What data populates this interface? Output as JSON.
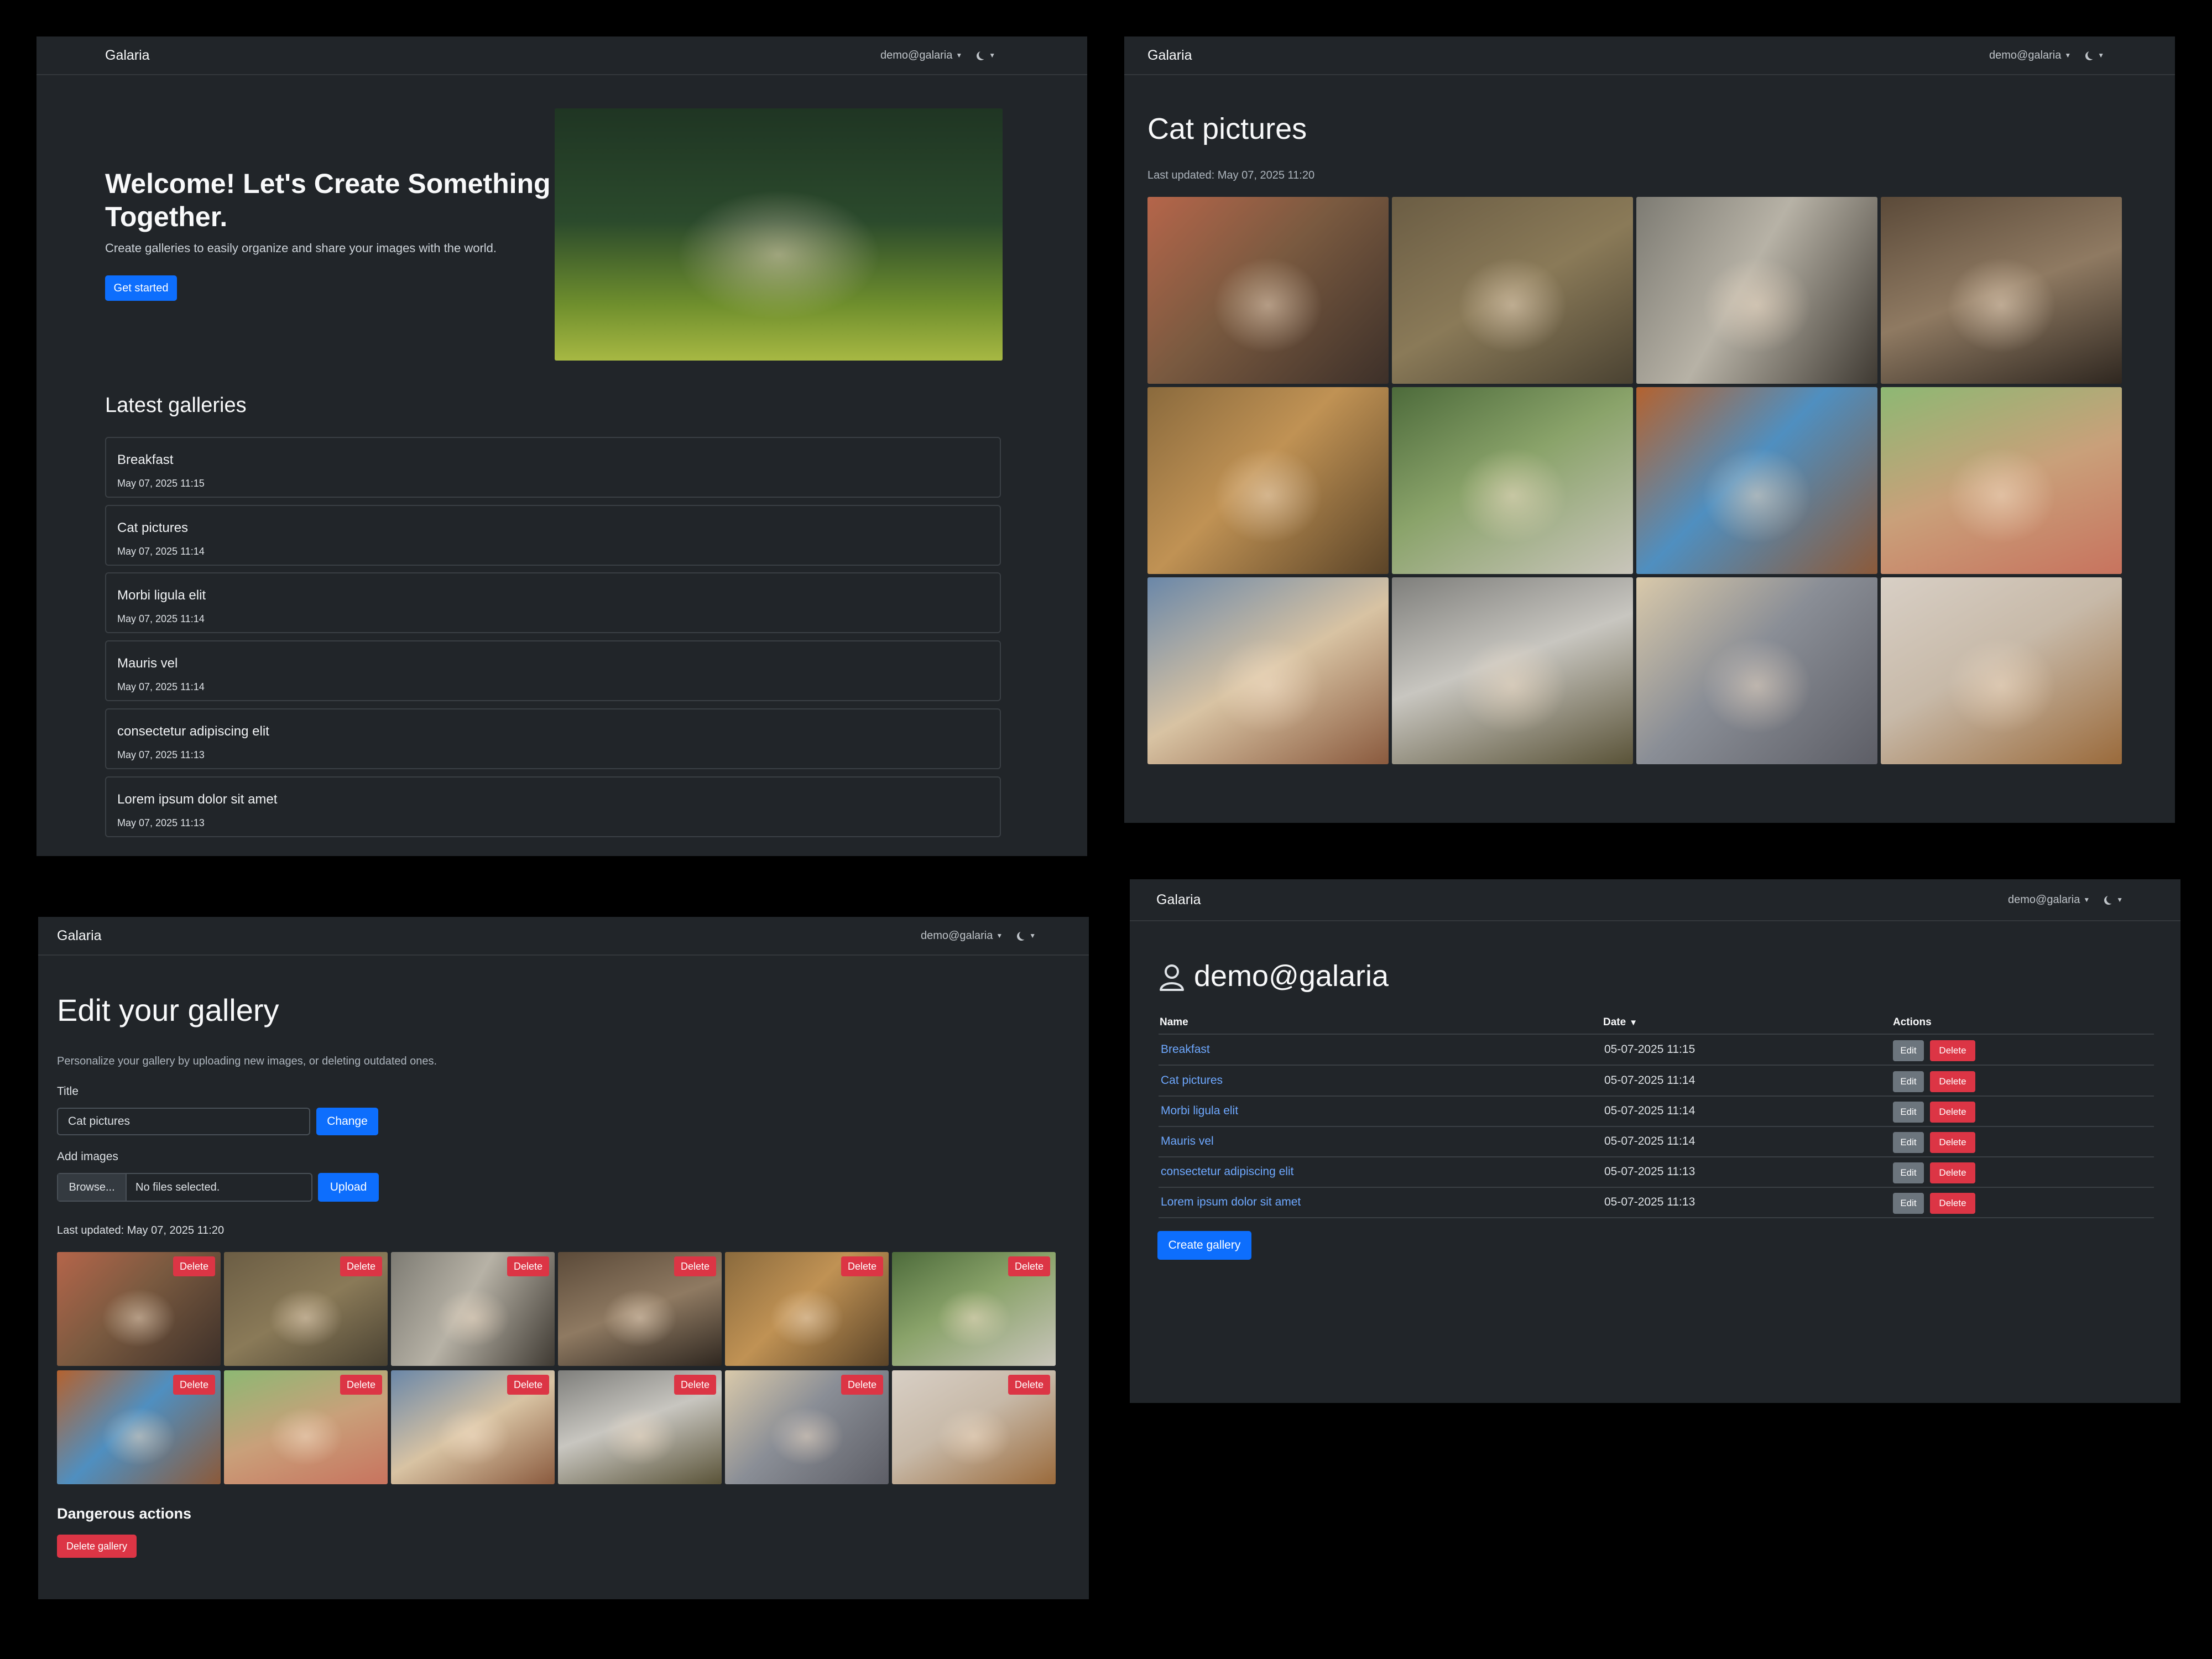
{
  "app": {
    "brand": "Galaria",
    "user": "demo@galaria"
  },
  "home": {
    "welcome_title": "Welcome! Let's Create Something Together.",
    "welcome_subtitle": "Create galleries to easily organize and share your images with the world.",
    "get_started_label": "Get started",
    "latest_title": "Latest galleries",
    "galleries": [
      {
        "name": "Breakfast",
        "date": "May 07, 2025 11:15"
      },
      {
        "name": "Cat pictures",
        "date": "May 07, 2025 11:14"
      },
      {
        "name": "Morbi ligula elit",
        "date": "May 07, 2025 11:14"
      },
      {
        "name": "Mauris vel",
        "date": "May 07, 2025 11:14"
      },
      {
        "name": "consectetur adipiscing elit",
        "date": "May 07, 2025 11:13"
      },
      {
        "name": "Lorem ipsum dolor sit amet",
        "date": "May 07, 2025 11:13"
      }
    ]
  },
  "gallery": {
    "title": "Cat pictures",
    "last_updated": "Last updated: May 07, 2025 11:20"
  },
  "edit": {
    "title": "Edit your gallery",
    "description": "Personalize your gallery by uploading new images, or deleting outdated ones.",
    "title_label": "Title",
    "title_value": "Cat pictures",
    "change_label": "Change",
    "add_images_label": "Add images",
    "browse_label": "Browse...",
    "no_files_label": "No files selected.",
    "upload_label": "Upload",
    "last_updated": "Last updated: May 07, 2025 11:20",
    "delete_label": "Delete",
    "dangerous_title": "Dangerous actions",
    "delete_gallery_label": "Delete gallery"
  },
  "profile": {
    "title": "demo@galaria",
    "columns": {
      "name": "Name",
      "date": "Date",
      "actions": "Actions"
    },
    "rows": [
      {
        "name": "Breakfast",
        "date": "05-07-2025 11:15"
      },
      {
        "name": "Cat pictures",
        "date": "05-07-2025 11:14"
      },
      {
        "name": "Morbi ligula elit",
        "date": "05-07-2025 11:14"
      },
      {
        "name": "Mauris vel",
        "date": "05-07-2025 11:14"
      },
      {
        "name": "consectetur adipiscing elit",
        "date": "05-07-2025 11:13"
      },
      {
        "name": "Lorem ipsum dolor sit amet",
        "date": "05-07-2025 11:13"
      }
    ],
    "edit_label": "Edit",
    "delete_label": "Delete",
    "create_label": "Create gallery"
  },
  "icons": {
    "user": "person-icon",
    "theme": "moon-icon",
    "sort": "sort-down-icon"
  },
  "colors": {
    "primary": "#0d6efd",
    "danger": "#dc3545",
    "secondary": "#6c757d",
    "link": "#6ea8fe",
    "background": "#212529"
  }
}
